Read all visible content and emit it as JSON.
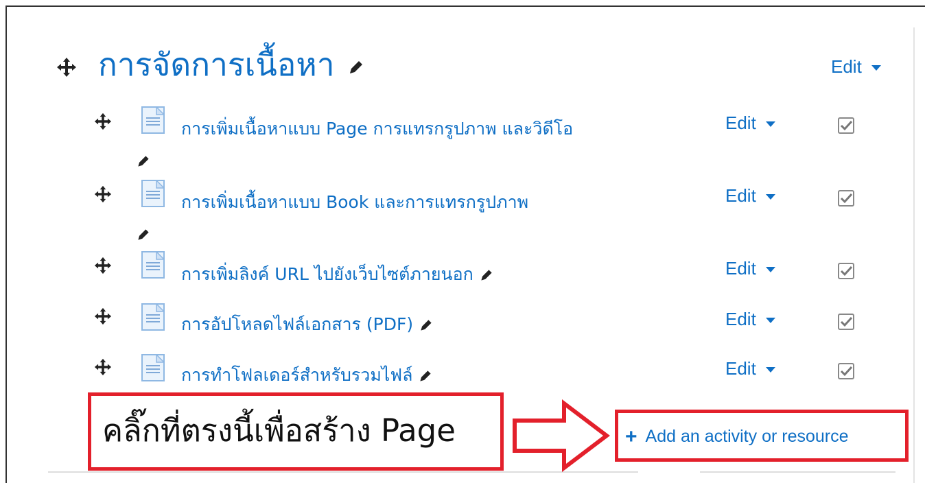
{
  "section": {
    "title": "การจัดการเนื้อหา",
    "edit_label": "Edit"
  },
  "activities": [
    {
      "label": "การเพิ่มเนื้อหาแบบ Page การแทรกรูปภาพ และวิดีโอ",
      "edit_label": "Edit"
    },
    {
      "label": "การเพิ่มเนื้อหาแบบ Book และการแทรกรูปภาพ",
      "edit_label": "Edit"
    },
    {
      "label": "การเพิ่มลิงค์ URL ไปยังเว็บไซต์ภายนอก",
      "edit_label": "Edit"
    },
    {
      "label": "การอัปโหลดไฟล์เอกสาร (PDF)",
      "edit_label": "Edit"
    },
    {
      "label": "การทำโฟลเดอร์สำหรับรวมไฟล์",
      "edit_label": "Edit"
    }
  ],
  "annotation": {
    "text": "คลิ๊กที่ตรงนี้เพื่อสร้าง Page"
  },
  "add_activity": {
    "label": "Add an activity or resource"
  },
  "icons": {
    "move": "move-icon",
    "pencil": "pencil-icon",
    "page": "page-icon",
    "checkbox": "checkbox-icon",
    "plus": "plus-icon",
    "arrow": "arrow-right-icon"
  },
  "colors": {
    "link": "#0f6fc5",
    "annotation": "#e3202b"
  }
}
